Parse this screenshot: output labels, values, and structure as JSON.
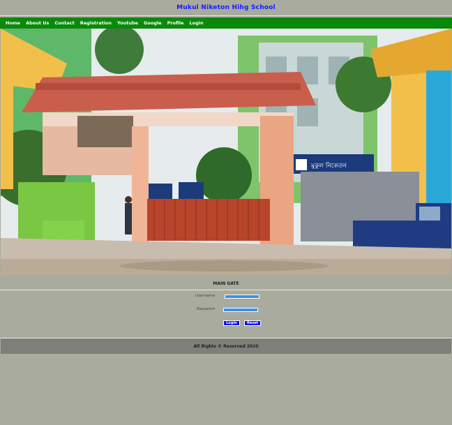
{
  "site": {
    "title": "Mukul Niketon Hihg School"
  },
  "nav": {
    "items": [
      "Home",
      "About Us",
      "Contact",
      "Registration",
      "Youtube",
      "Google",
      "Profile",
      "Login"
    ]
  },
  "hero": {
    "caption": "MAIN GATE",
    "signboard_text": "মুকুল নিকেতন"
  },
  "login_form": {
    "username_label": "Username",
    "password_label": "Password",
    "username_value": "",
    "password_value": "",
    "login_button": "Login",
    "reset_button": "Reset"
  },
  "footer": {
    "text": "All Rights © Reserved 2020"
  },
  "colors": {
    "background": "#a9ab9f",
    "nav_green": "#0a8a0a",
    "title_blue": "#1a1aff",
    "input_blue": "#3f8fe8",
    "button_blue": "#1010ee",
    "footer_gray": "#7e7f7b"
  }
}
